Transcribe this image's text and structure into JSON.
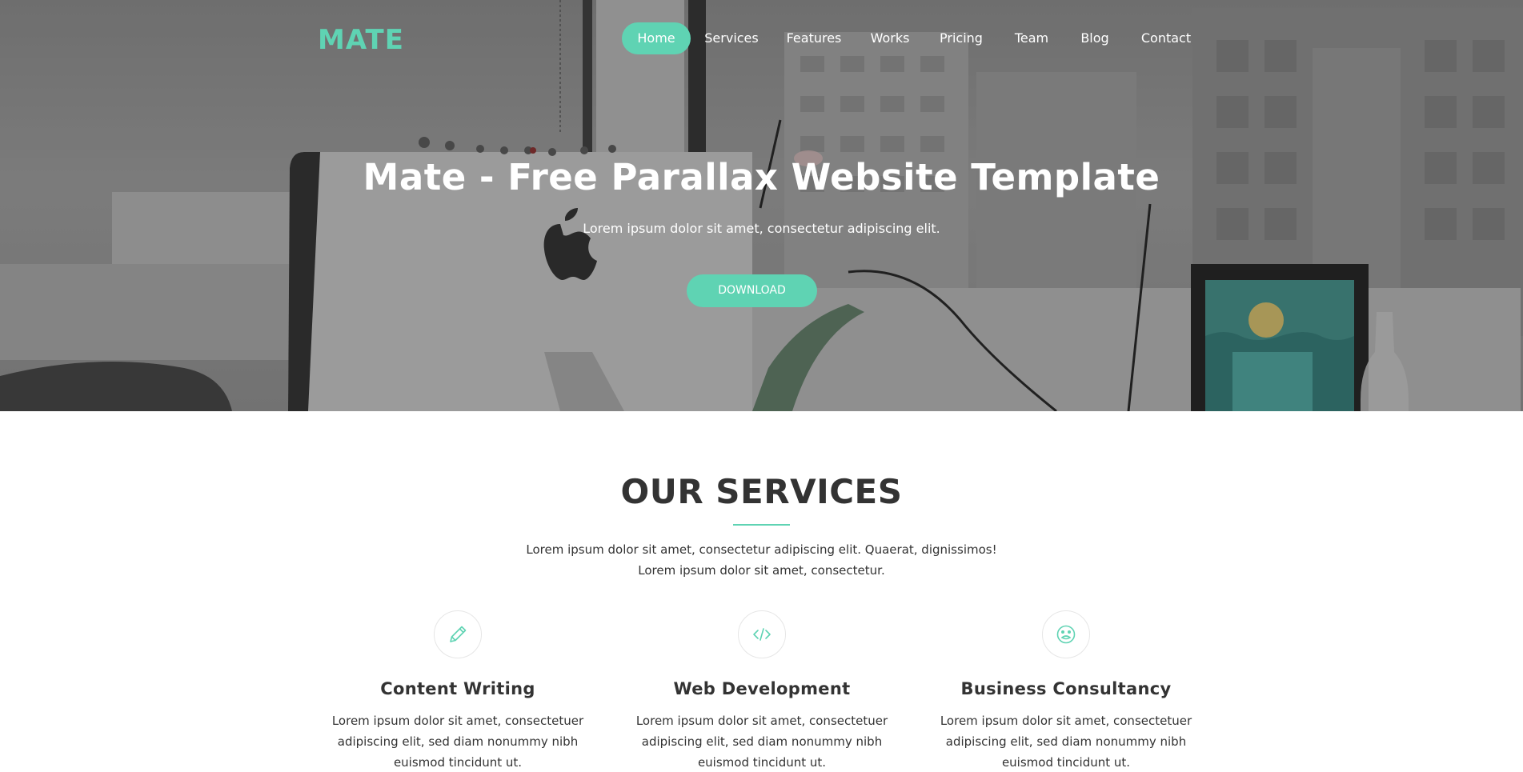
{
  "brand": {
    "logo": "MATE",
    "accent": "#5fd3b3"
  },
  "nav": {
    "items": [
      {
        "label": "Home",
        "active": true
      },
      {
        "label": "Services"
      },
      {
        "label": "Features"
      },
      {
        "label": "Works"
      },
      {
        "label": "Pricing"
      },
      {
        "label": "Team"
      },
      {
        "label": "Blog"
      },
      {
        "label": "Contact"
      }
    ]
  },
  "hero": {
    "title": "Mate - Free Parallax Website Template",
    "subtitle": "Lorem ipsum dolor sit amet, consectetur adipiscing elit.",
    "button": "DOWNLOAD"
  },
  "services": {
    "title": "OUR SERVICES",
    "desc_line1": "Lorem ipsum dolor sit amet, consectetur adipiscing elit. Quaerat, dignissimos!",
    "desc_line2": "Lorem ipsum dolor sit amet, consectetur.",
    "items": [
      {
        "icon": "pencil-icon",
        "title": "Content Writing",
        "text_line1": "Lorem ipsum dolor sit amet, consectetuer",
        "text_line2": "adipiscing elit, sed diam nonummy nibh",
        "text_line3": "euismod tincidunt ut."
      },
      {
        "icon": "code-icon",
        "title": "Web Development",
        "text_line1": "Lorem ipsum dolor sit amet, consectetuer",
        "text_line2": "adipiscing elit, sed diam nonummy nibh",
        "text_line3": "euismod tincidunt ut."
      },
      {
        "icon": "smiley-face-icon",
        "title": "Business Consultancy",
        "text_line1": "Lorem ipsum dolor sit amet, consectetuer",
        "text_line2": "adipiscing elit, sed diam nonummy nibh",
        "text_line3": "euismod tincidunt ut."
      }
    ]
  }
}
